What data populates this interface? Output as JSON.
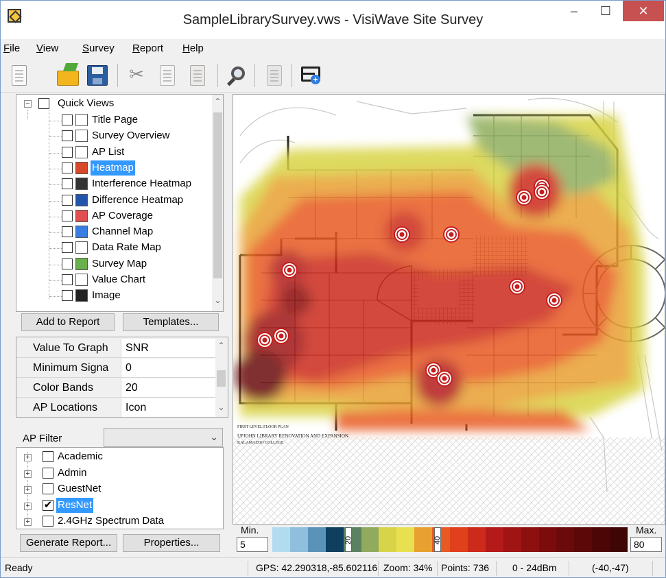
{
  "window": {
    "title": "SampleLibrarySurvey.vws - VisiWave Site Survey",
    "min": "‒",
    "max": "☐",
    "close": "✕"
  },
  "menu": [
    "File",
    "View",
    "Survey",
    "Report",
    "Help"
  ],
  "toolbar": {
    "icons": [
      "new-report-icon",
      "open-folder-icon",
      "save-disk-icon",
      "cut-scissors-icon",
      "copy-icon",
      "paste-clipboard-icon",
      "zoom-magnifier-icon",
      "check-report-icon",
      "add-floor-map-icon"
    ]
  },
  "quick_views": {
    "root": "Quick Views",
    "items": [
      {
        "label": "Title Page",
        "icon": "title-page-icon",
        "checked": false
      },
      {
        "label": "Survey Overview",
        "icon": "survey-overview-icon",
        "checked": false
      },
      {
        "label": "AP List",
        "icon": "ap-list-icon",
        "checked": false
      },
      {
        "label": "Heatmap",
        "icon": "heatmap-icon",
        "checked": false,
        "selected": true
      },
      {
        "label": "Interference Heatmap",
        "icon": "interference-heatmap-icon",
        "checked": false
      },
      {
        "label": "Difference Heatmap",
        "icon": "difference-heatmap-icon",
        "checked": false
      },
      {
        "label": "AP Coverage",
        "icon": "ap-coverage-icon",
        "checked": false
      },
      {
        "label": "Channel Map",
        "icon": "channel-map-icon",
        "checked": false
      },
      {
        "label": "Data Rate Map",
        "icon": "data-rate-map-icon",
        "checked": false
      },
      {
        "label": "Survey Map",
        "icon": "survey-map-icon",
        "checked": false
      },
      {
        "label": "Value Chart",
        "icon": "value-chart-icon",
        "checked": false
      },
      {
        "label": "Image",
        "icon": "camera-icon",
        "checked": false
      }
    ]
  },
  "buttons": {
    "add_to_report": "Add to Report",
    "templates": "Templates...",
    "generate_report": "Generate Report...",
    "properties": "Properties..."
  },
  "properties": [
    {
      "name": "Value To Graph",
      "value": "SNR"
    },
    {
      "name": "Minimum Signa",
      "value": "0"
    },
    {
      "name": "Color Bands",
      "value": "20"
    },
    {
      "name": "AP Locations",
      "value": "Icon"
    }
  ],
  "ap_filter": {
    "label": "AP Filter",
    "selected": "",
    "items": [
      {
        "label": "Academic",
        "checked": false,
        "selected": false
      },
      {
        "label": "Admin",
        "checked": false,
        "selected": false
      },
      {
        "label": "GuestNet",
        "checked": false,
        "selected": false
      },
      {
        "label": "ResNet",
        "checked": true,
        "selected": true
      },
      {
        "label": "2.4GHz Spectrum Data",
        "checked": false,
        "selected": false
      }
    ]
  },
  "map": {
    "plan_caption": "FIRST LEVEL FLOOR PLAN",
    "project_line1": "UPJOHN LIBRARY RENOVATION AND EXPANSION",
    "project_line2": "KALAMAZOO COLLEGE",
    "ap_icon": "access-point-target-icon"
  },
  "legend": {
    "min_label": "Min.",
    "min_value": "5",
    "max_label": "Max.",
    "max_value": "80",
    "marker_20": "20",
    "marker_40": "40",
    "bands": [
      "#b3dbef",
      "#8fbfdc",
      "#5b93b8",
      "#0f3f5f",
      "#5b8260",
      "#91ab5e",
      "#d8d44a",
      "#e8e050",
      "#e8a030",
      "#e85a22",
      "#e0401c",
      "#cc2a1a",
      "#b51a1a",
      "#a01414",
      "#8c1010",
      "#7c0c0c",
      "#6b0a0a",
      "#5c0808",
      "#4d0606",
      "#400606"
    ]
  },
  "status": {
    "ready": "Ready",
    "gps": "GPS: 42.290318,-85.602116",
    "zoom": "Zoom: 34%",
    "points": "Points: 736",
    "range": "0 - 24dBm",
    "coords": "(-40,-47)"
  }
}
